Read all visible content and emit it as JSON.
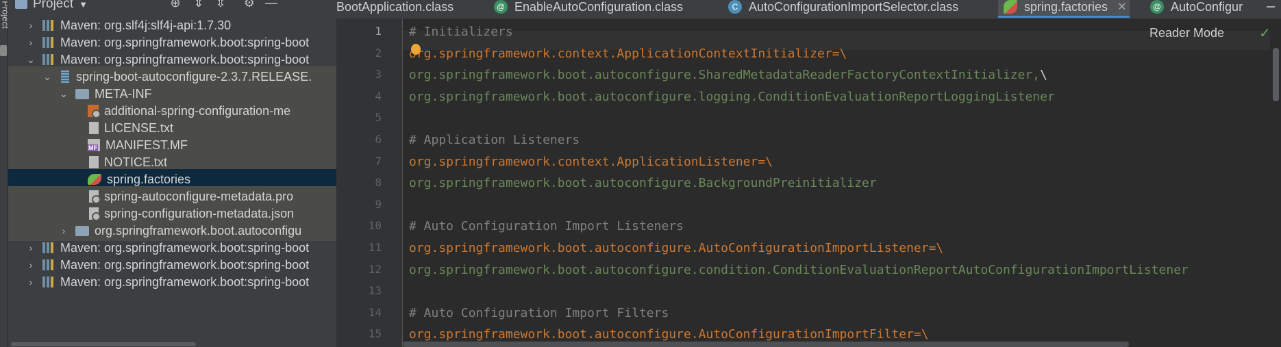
{
  "tool_strip": {
    "label": "Project"
  },
  "project_panel": {
    "title": "Project",
    "tree": [
      {
        "label": "Maven: org.slf4j:slf4j-api:1.7.30",
        "icon": "library-icon",
        "expanded": false
      },
      {
        "label": "Maven: org.springframework.boot:spring-boot",
        "icon": "library-icon",
        "expanded": false
      },
      {
        "label": "Maven: org.springframework.boot:spring-boot",
        "icon": "library-icon",
        "expanded": true
      },
      {
        "label": "spring-boot-autoconfigure-2.3.7.RELEASE.",
        "icon": "jar-icon",
        "expanded": true
      },
      {
        "label": "META-INF",
        "icon": "folder-icon",
        "expanded": true
      },
      {
        "label": "additional-spring-configuration-me",
        "icon": "metadata-file-icon"
      },
      {
        "label": "LICENSE.txt",
        "icon": "text-file-icon"
      },
      {
        "label": "MANIFEST.MF",
        "icon": "manifest-file-icon"
      },
      {
        "label": "NOTICE.txt",
        "icon": "text-file-icon"
      },
      {
        "label": "spring.factories",
        "icon": "spring-factories-icon",
        "selected": true
      },
      {
        "label": "spring-autoconfigure-metadata.pro",
        "icon": "properties-file-icon"
      },
      {
        "label": "spring-configuration-metadata.json",
        "icon": "properties-file-icon"
      },
      {
        "label": "org.springframework.boot.autoconfigu",
        "icon": "package-folder-icon",
        "expanded": false
      },
      {
        "label": "Maven: org.springframework.boot:spring-boot",
        "icon": "library-icon",
        "expanded": false
      },
      {
        "label": "Maven: org.springframework.boot:spring-boot",
        "icon": "library-icon",
        "expanded": false
      },
      {
        "label": "Maven: org.springframework.boot:spring-boot",
        "icon": "library-icon",
        "expanded": false
      }
    ]
  },
  "tabs": [
    {
      "label": "BootApplication.class",
      "icon": ""
    },
    {
      "label": "EnableAutoConfiguration.class",
      "icon": "annotation-class-icon"
    },
    {
      "label": "AutoConfigurationImportSelector.class",
      "icon": "class-icon"
    },
    {
      "label": "spring.factories",
      "icon": "spring-factories-icon",
      "active": true
    },
    {
      "label": "AutoConfigur",
      "icon": "annotation-class-icon"
    }
  ],
  "editor": {
    "reader_mode": "Reader Mode",
    "current_line": 1,
    "lines": [
      {
        "n": "1",
        "type": "comment",
        "text": "# Initializers"
      },
      {
        "n": "2",
        "type": "key",
        "text": "org.springframework.context.ApplicationContextInitializer",
        "tail": "=\\"
      },
      {
        "n": "3",
        "type": "val",
        "text": "org.springframework.boot.autoconfigure.SharedMetadataReaderFactoryContextInitializer,",
        "tail": "\\"
      },
      {
        "n": "4",
        "type": "val",
        "text": "org.springframework.boot.autoconfigure.logging.ConditionEvaluationReportLoggingListener"
      },
      {
        "n": "5",
        "type": "blank",
        "text": ""
      },
      {
        "n": "6",
        "type": "comment",
        "text": "# Application Listeners"
      },
      {
        "n": "7",
        "type": "key",
        "text": "org.springframework.context.ApplicationListener",
        "tail": "=\\"
      },
      {
        "n": "8",
        "type": "val",
        "text": "org.springframework.boot.autoconfigure.BackgroundPreinitializer"
      },
      {
        "n": "9",
        "type": "blank",
        "text": ""
      },
      {
        "n": "10",
        "type": "comment",
        "text": "# Auto Configuration Import Listeners"
      },
      {
        "n": "11",
        "type": "key",
        "text": "org.springframework.boot.autoconfigure.AutoConfigurationImportListener",
        "tail": "=\\"
      },
      {
        "n": "12",
        "type": "val",
        "text": "org.springframework.boot.autoconfigure.condition.ConditionEvaluationReportAutoConfigurationImportListener"
      },
      {
        "n": "13",
        "type": "blank",
        "text": ""
      },
      {
        "n": "14",
        "type": "comment",
        "text": "# Auto Configuration Import Filters"
      },
      {
        "n": "15",
        "type": "key",
        "text": "org.springframework.boot.autoconfigure.AutoConfigurationImportFilter",
        "tail": "=\\"
      }
    ]
  }
}
